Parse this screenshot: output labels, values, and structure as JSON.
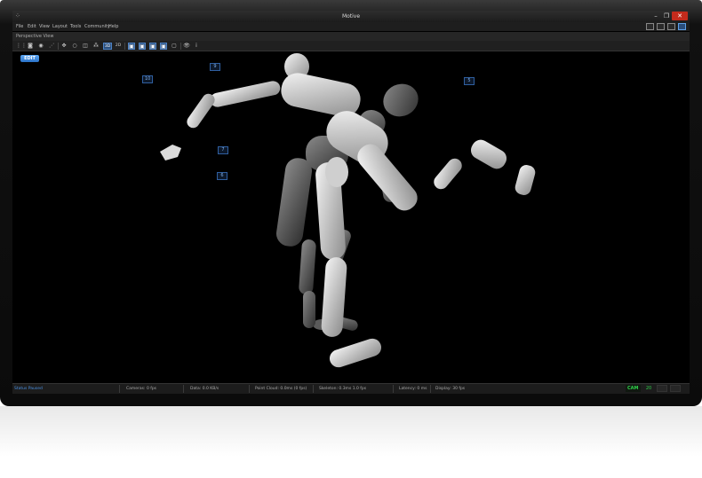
{
  "window": {
    "title": "Motive"
  },
  "menu": [
    "File",
    "Edit",
    "View",
    "Layout",
    "Tools",
    "Community",
    "Help"
  ],
  "view": {
    "title": "Perspective View"
  },
  "toolbar": {
    "label_3d": "3D",
    "label_2d": "2D"
  },
  "viewport": {
    "edit_label": "EDIT",
    "camera_labels": [
      "9",
      "10",
      "5",
      "7",
      "6"
    ]
  },
  "status": {
    "text": "Status Paused",
    "cameras": "Cameras: 0 fps",
    "data": "Data: 0.0 KB/s",
    "point_cloud": "Point Cloud: 0.0ms (0 fps)",
    "skeleton": "Skeleton: 0.3ms 1.0 fps",
    "latency": "Latency: 0 ms",
    "display": "Display: 30 fps",
    "cam_label": "CAM",
    "cam_count": "20"
  },
  "colors": {
    "accent": "#4a90e2",
    "cam_green": "#2fd04a",
    "close_red": "#c42b1c"
  }
}
